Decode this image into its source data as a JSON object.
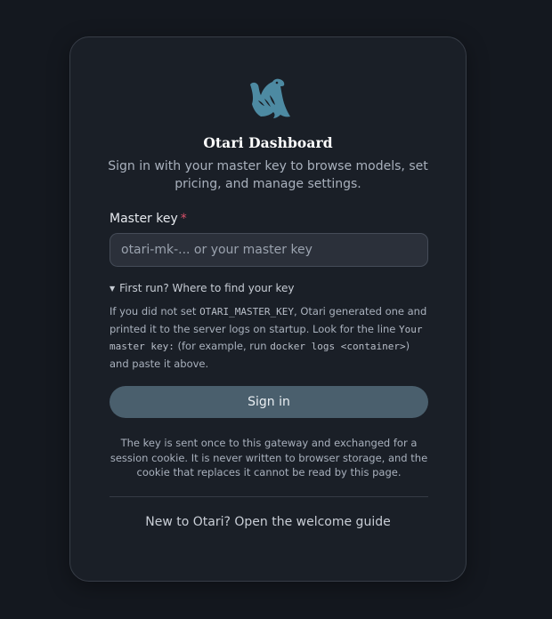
{
  "app": {
    "title": "Otari Dashboard",
    "subtitle": "Sign in with your master key to browse models, set pricing, and manage settings."
  },
  "brand": {
    "logo_icon": "seal-icon",
    "logo_color": "#4d8aa2"
  },
  "form": {
    "master_key_label": "Master key",
    "required_marker": "*",
    "master_key_value": "",
    "master_key_placeholder": "otari-mk-... or your master key",
    "signin_label": "Sign in"
  },
  "help": {
    "summary": "First run? Where to find your key",
    "text_1": "If you did not set ",
    "env_var": "OTARI_MASTER_KEY",
    "text_2": ", Otari generated one and printed it to the server logs on startup. Look for the line ",
    "log_line": "Your master key:",
    "text_3": " (for example, run ",
    "docker_cmd": "docker logs <container>",
    "text_4": ") and paste it above."
  },
  "notice": {
    "text": "The key is sent once to this gateway and exchanged for a session cookie. It is never written to browser storage, and the cookie that replaces it cannot be read by this page."
  },
  "footer": {
    "welcome_link": "New to Otari? Open the welcome guide"
  },
  "colors": {
    "background": "#14181f",
    "card": "#1a1f27",
    "button": "#4a5f6d",
    "required": "#d9506a"
  }
}
